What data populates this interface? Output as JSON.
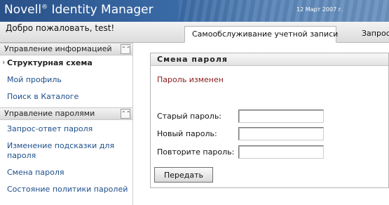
{
  "header": {
    "product": "Novell",
    "registered": "®",
    "product_rest": " Identity Manager",
    "date": "12 Март 2007 г."
  },
  "subbar": {
    "welcome": "Добро пожаловать, test!",
    "tabs": [
      {
        "label": "Самообслуживание учетной записи",
        "active": true
      },
      {
        "label": "Запрос",
        "active": false
      }
    ]
  },
  "nav": {
    "sections": [
      {
        "title": "Управление информацией",
        "items": [
          {
            "label": "Структурная схема",
            "current": true
          },
          {
            "label": "Мой профиль"
          },
          {
            "label": "Поиск в Каталоге"
          }
        ]
      },
      {
        "title": "Управление паролями",
        "items": [
          {
            "label": "Запрос-ответ пароля"
          },
          {
            "label": "Изменение подсказки для пароля"
          },
          {
            "label": "Смена пароля"
          },
          {
            "label": "Состояние политики паролей"
          }
        ]
      }
    ]
  },
  "main": {
    "title": "Смена пароля",
    "status": "Пароль изменен",
    "fields": [
      {
        "label": "Старый пароль:",
        "value": ""
      },
      {
        "label": "Новый пароль:",
        "value": ""
      },
      {
        "label": "Повторите пароль:",
        "value": ""
      }
    ],
    "submit_label": "Передать"
  },
  "colors": {
    "banner": "#2a5188",
    "link": "#1e4e8c",
    "status": "#8b1a1a"
  }
}
